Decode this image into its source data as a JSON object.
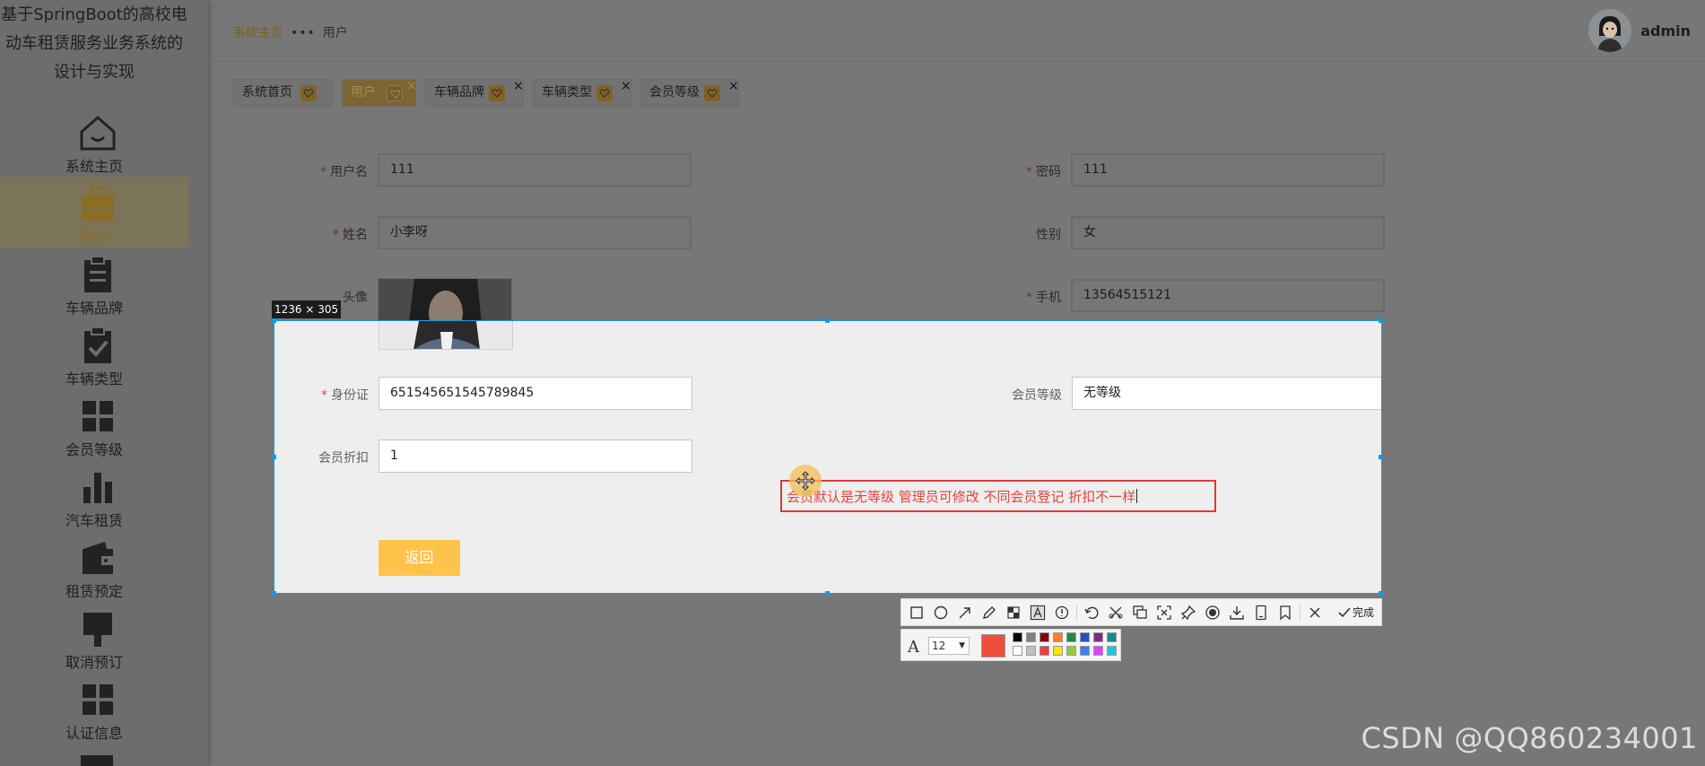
{
  "app": {
    "title": "基于SpringBoot的高校电动车租赁服务业务系统的设计与实现"
  },
  "sidebar": {
    "items": [
      {
        "label": "系统主页",
        "icon": "home-icon"
      },
      {
        "label": "用户",
        "icon": "briefcase-icon",
        "active": true
      },
      {
        "label": "车辆品牌",
        "icon": "clipboard-icon"
      },
      {
        "label": "车辆类型",
        "icon": "clipboard-check-icon"
      },
      {
        "label": "会员等级",
        "icon": "grid-icon"
      },
      {
        "label": "汽车租赁",
        "icon": "bar-chart-icon"
      },
      {
        "label": "租赁预定",
        "icon": "wallet-icon"
      },
      {
        "label": "取消预订",
        "icon": "brush-icon"
      },
      {
        "label": "认证信息",
        "icon": "grid-icon"
      }
    ]
  },
  "breadcrumb": {
    "home": "系统主页",
    "separator": "•••",
    "current": "用户"
  },
  "user": {
    "name": "admin"
  },
  "tags": [
    {
      "label": "系统首页",
      "active": false,
      "closable": false
    },
    {
      "label": "用户",
      "active": true,
      "closable": true
    },
    {
      "label": "车辆品牌",
      "active": false,
      "closable": true
    },
    {
      "label": "车辆类型",
      "active": false,
      "closable": true
    },
    {
      "label": "会员等级",
      "active": false,
      "closable": true
    }
  ],
  "form": {
    "username": {
      "label": "用户名",
      "value": "111",
      "required": true
    },
    "password": {
      "label": "密码",
      "value": "111",
      "required": true
    },
    "name": {
      "label": "姓名",
      "value": "小李呀",
      "required": true
    },
    "gender": {
      "label": "性别",
      "value": "女",
      "required": false
    },
    "avatar": {
      "label": "头像"
    },
    "phone": {
      "label": "手机",
      "value": "13564515121",
      "required": true
    },
    "id_card": {
      "label": "身份证",
      "value": "651545651545789845",
      "required": true
    },
    "member_level": {
      "label": "会员等级",
      "value": "无等级",
      "required": false
    },
    "member_discount": {
      "label": "会员折扣",
      "value": "1",
      "required": false
    },
    "back_label": "返回"
  },
  "capture": {
    "size": "1236 × 305",
    "annotation": "会员默认是无等级  管理员可修改  不同会员登记 折扣不一样",
    "annotation_color": "#e3453b",
    "selection_color": "#0f9ee5"
  },
  "toolbar": {
    "tools": [
      "rectangle-icon",
      "ellipse-icon",
      "arrow-icon",
      "pencil-icon",
      "mosaic-icon",
      "text-icon",
      "serial-number-icon",
      "undo-icon",
      "cut-icon",
      "copy-icon",
      "long-screenshot-icon",
      "pin-icon",
      "record-icon",
      "download-icon",
      "phone-icon",
      "bookmark-icon",
      "close-icon"
    ],
    "done_label": "完成",
    "font_size": "12",
    "current_color": "#f04d3c",
    "palette": [
      "#000000",
      "#808080",
      "#800000",
      "#ff7f27",
      "#1e8b3d",
      "#2a4fb8",
      "#7a2a8f",
      "#128c8c",
      "#ffffff",
      "#c0c0c0",
      "#f03c3c",
      "#ffe400",
      "#93c83e",
      "#3c7ff0",
      "#e040fb",
      "#22c6d8"
    ]
  },
  "watermark": "CSDN @QQ860234001"
}
